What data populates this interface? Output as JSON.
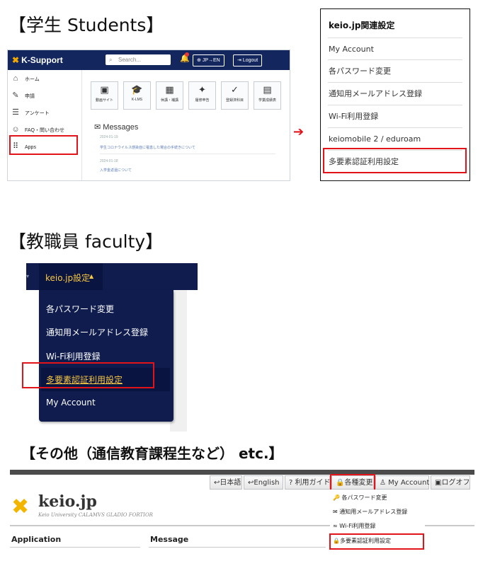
{
  "sections": {
    "students": "【学生 Students】",
    "faculty": "【教職員 faculty】",
    "others": "【その他（通信教育課程生など） etc.】"
  },
  "ksupport": {
    "logo": "K-Support",
    "search_placeholder": "Search...",
    "lang_button": "JP→EN",
    "logout_button": "Logout",
    "sidebar": [
      "ホーム",
      "申請",
      "アンケート",
      "FAQ・問い合わせ",
      "Apps"
    ],
    "tiles": [
      "動画サイト",
      "K-LMS",
      "休講・補講",
      "履修申告",
      "登録済科目",
      "学業成績表"
    ],
    "messages_heading": "Messages",
    "messages": [
      {
        "date": "2024-01-19",
        "text": "学生コロナウイルス感染症に罹患した場合の手続きについて"
      },
      {
        "date": "2024-01-18",
        "text": "入学金返還について"
      }
    ]
  },
  "keio_panel": {
    "title": "keio.jp関連設定",
    "items": [
      "My Account",
      "各パスワード変更",
      "通知用メールアドレス登録",
      "Wi-Fi利用登録",
      "keiomobile 2 / eduroam",
      "多要素認証利用設定"
    ]
  },
  "faculty_menu": {
    "tab": "keio.jp設定",
    "items": [
      "各パスワード変更",
      "通知用メールアドレス登録",
      "Wi-Fi利用登録",
      "多要素認証利用設定",
      "My Account"
    ]
  },
  "keiojp": {
    "buttons": [
      "日本語",
      "English",
      "利用ガイド",
      "各種変更",
      "My Account",
      "ログオフ"
    ],
    "logo": "keio.jp",
    "subtitle": "Keio University CALAMVS GLADIO FORTIOR",
    "col_application": "Application",
    "col_message": "Message",
    "dropdown": [
      "各パスワード変更",
      "通知用メールアドレス登録",
      "Wi-Fi利用登録",
      "多要素認証利用設定"
    ]
  },
  "colors": {
    "navy": "#0f1c4d",
    "highlight_red": "#e3131a",
    "gold": "#f6c744"
  }
}
